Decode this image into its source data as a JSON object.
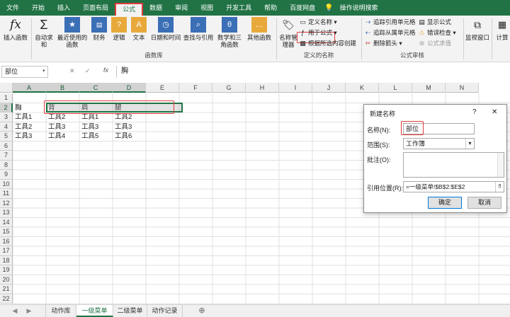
{
  "ribbon_tabs": [
    "文件",
    "开始",
    "插入",
    "页面布局",
    "公式",
    "数据",
    "审阅",
    "视图",
    "开发工具",
    "帮助",
    "百度网盘",
    "操作说明搜索"
  ],
  "ribbon": {
    "insert_function": "插入函数",
    "function_library": [
      "自动求和",
      "最近使用的函数",
      "财务",
      "逻辑",
      "文本",
      "日期和时间",
      "查找与引用",
      "数学和三角函数",
      "其他函数"
    ],
    "group_function_library": "函数库",
    "name_manager": "名称管理器",
    "define_name": "定义名称",
    "use_in_formula": "用于公式",
    "create_from_selection": "根据所选内容创建",
    "group_defined_names": "定义的名称",
    "trace_precedents": "追踪引用单元格",
    "trace_dependents": "追踪从属单元格",
    "remove_arrows": "删除箭头",
    "show_formulas": "显示公式",
    "error_checking": "错误检查",
    "evaluate_formula": "公式求值",
    "group_formula_auditing": "公式审核",
    "watch_window": "监视窗口",
    "calc_options": "计算"
  },
  "formula_bar": {
    "name_box": "部位",
    "content": "胸",
    "fx": "fx",
    "cancel": "✕",
    "enter": "✓"
  },
  "columns": [
    "A",
    "B",
    "C",
    "D",
    "E",
    "F",
    "G",
    "H",
    "I",
    "J",
    "K",
    "L",
    "M",
    "N"
  ],
  "rows": [
    "1",
    "2",
    "3",
    "4",
    "5",
    "6",
    "7",
    "8",
    "9",
    "10",
    "11",
    "12",
    "13",
    "14",
    "15",
    "16",
    "17",
    "18",
    "19",
    "20",
    "21",
    "22"
  ],
  "cells": {
    "row2": [
      "胸",
      "背",
      "肩",
      "腿"
    ],
    "row3": [
      "工具1",
      "工具2",
      "工具1",
      "工具2"
    ],
    "row4": [
      "工具2",
      "工具3",
      "工具3",
      "工具3"
    ],
    "row5": [
      "工具3",
      "工具4",
      "工具5",
      "工具6"
    ]
  },
  "dialog": {
    "title": "新建名称",
    "help": "?",
    "close": "✕",
    "name_label": "名称(N):",
    "name_value": "部位",
    "scope_label": "范围(S):",
    "scope_value": "工作簿",
    "comment_label": "批注(O):",
    "ref_label": "引用位置(R):",
    "ref_value": "=一级菜单!$B$2:$E$2",
    "ok": "确定",
    "cancel": "取消"
  },
  "sheet_tabs": [
    "动作库",
    "一级菜单",
    "二级菜单",
    "动作记录"
  ],
  "sheet_nav": {
    "prev": "◀",
    "next": "▶",
    "add": "⊕"
  },
  "colors": {
    "excel_green": "#217346",
    "highlight_red": "#e03b3b"
  }
}
